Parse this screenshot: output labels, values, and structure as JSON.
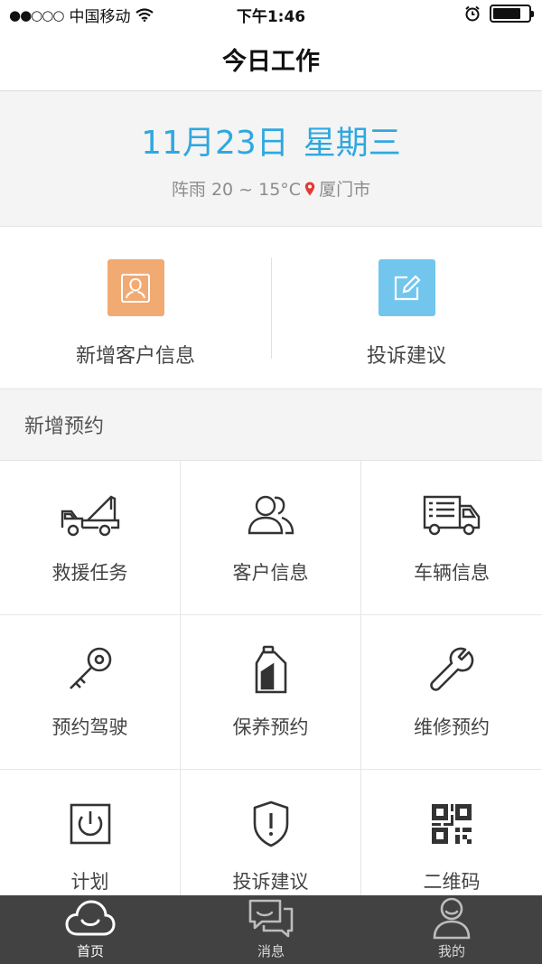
{
  "status_bar": {
    "signal_dots": "●●○○○",
    "carrier": "中国移动",
    "time": "下午1:46",
    "battery_level": 0.8
  },
  "header": {
    "title": "今日工作"
  },
  "date_info": {
    "date": "11月23日",
    "weekday": "星期三",
    "weather": "阵雨 20 ~ 15°C",
    "city": "厦门市"
  },
  "quick_actions": [
    {
      "label": "新增客户信息",
      "icon": "user-icon",
      "color": "#f2aa73"
    },
    {
      "label": "投诉建议",
      "icon": "edit-icon",
      "color": "#72c6ee"
    }
  ],
  "section": {
    "title": "新增预约"
  },
  "grid_items": [
    {
      "label": "救援任务",
      "icon": "tow-truck-icon"
    },
    {
      "label": "客户信息",
      "icon": "users-icon"
    },
    {
      "label": "车辆信息",
      "icon": "truck-icon"
    },
    {
      "label": "预约驾驶",
      "icon": "key-icon"
    },
    {
      "label": "保养预约",
      "icon": "oil-bottle-icon"
    },
    {
      "label": "维修预约",
      "icon": "wrench-icon"
    },
    {
      "label": "计划",
      "icon": "timer-icon"
    },
    {
      "label": "投诉建议",
      "icon": "shield-alert-icon"
    },
    {
      "label": "二维码",
      "icon": "qr-code-icon"
    }
  ],
  "tab_bar": [
    {
      "label": "首页",
      "icon": "cloud-smile-icon",
      "active": true
    },
    {
      "label": "消息",
      "icon": "chat-icon",
      "active": false
    },
    {
      "label": "我的",
      "icon": "person-icon",
      "active": false
    }
  ],
  "colors": {
    "accent": "#2ea8e0",
    "tabbar": "#424242"
  }
}
